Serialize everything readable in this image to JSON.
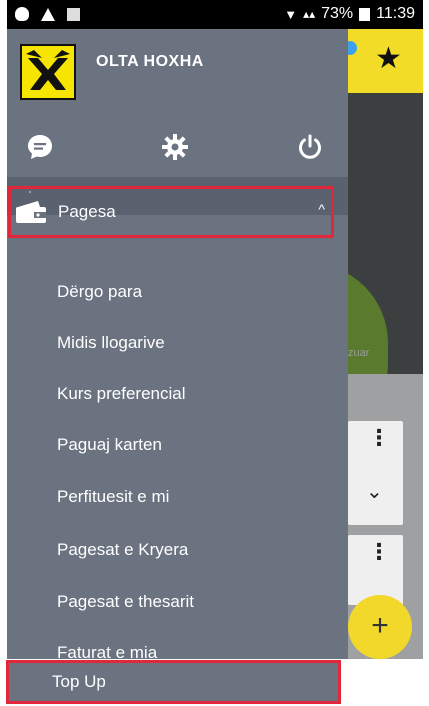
{
  "status_bar": {
    "signal_text": "73%",
    "time": "11:39"
  },
  "drawer": {
    "user_name": "OLTA HOXHA",
    "header_icons": [
      "chat-icon",
      "gear-icon",
      "power-icon"
    ],
    "menu": {
      "pagesa_label": "Pagesa",
      "sub_items": [
        "Dërgo para",
        "Midis llogarive",
        "Kurs preferencial",
        "Paguaj karten",
        "Perfituesit e mi",
        "Pagesat e Kryera",
        "Pagesat e thesarit",
        "Faturat e mia",
        "Top Up"
      ]
    }
  },
  "background": {
    "partial_label": "zuar",
    "fab_label": "+"
  },
  "colors": {
    "drawer": "#6b7380",
    "highlight": "#e0283a",
    "brand_yellow": "#f6e500"
  }
}
